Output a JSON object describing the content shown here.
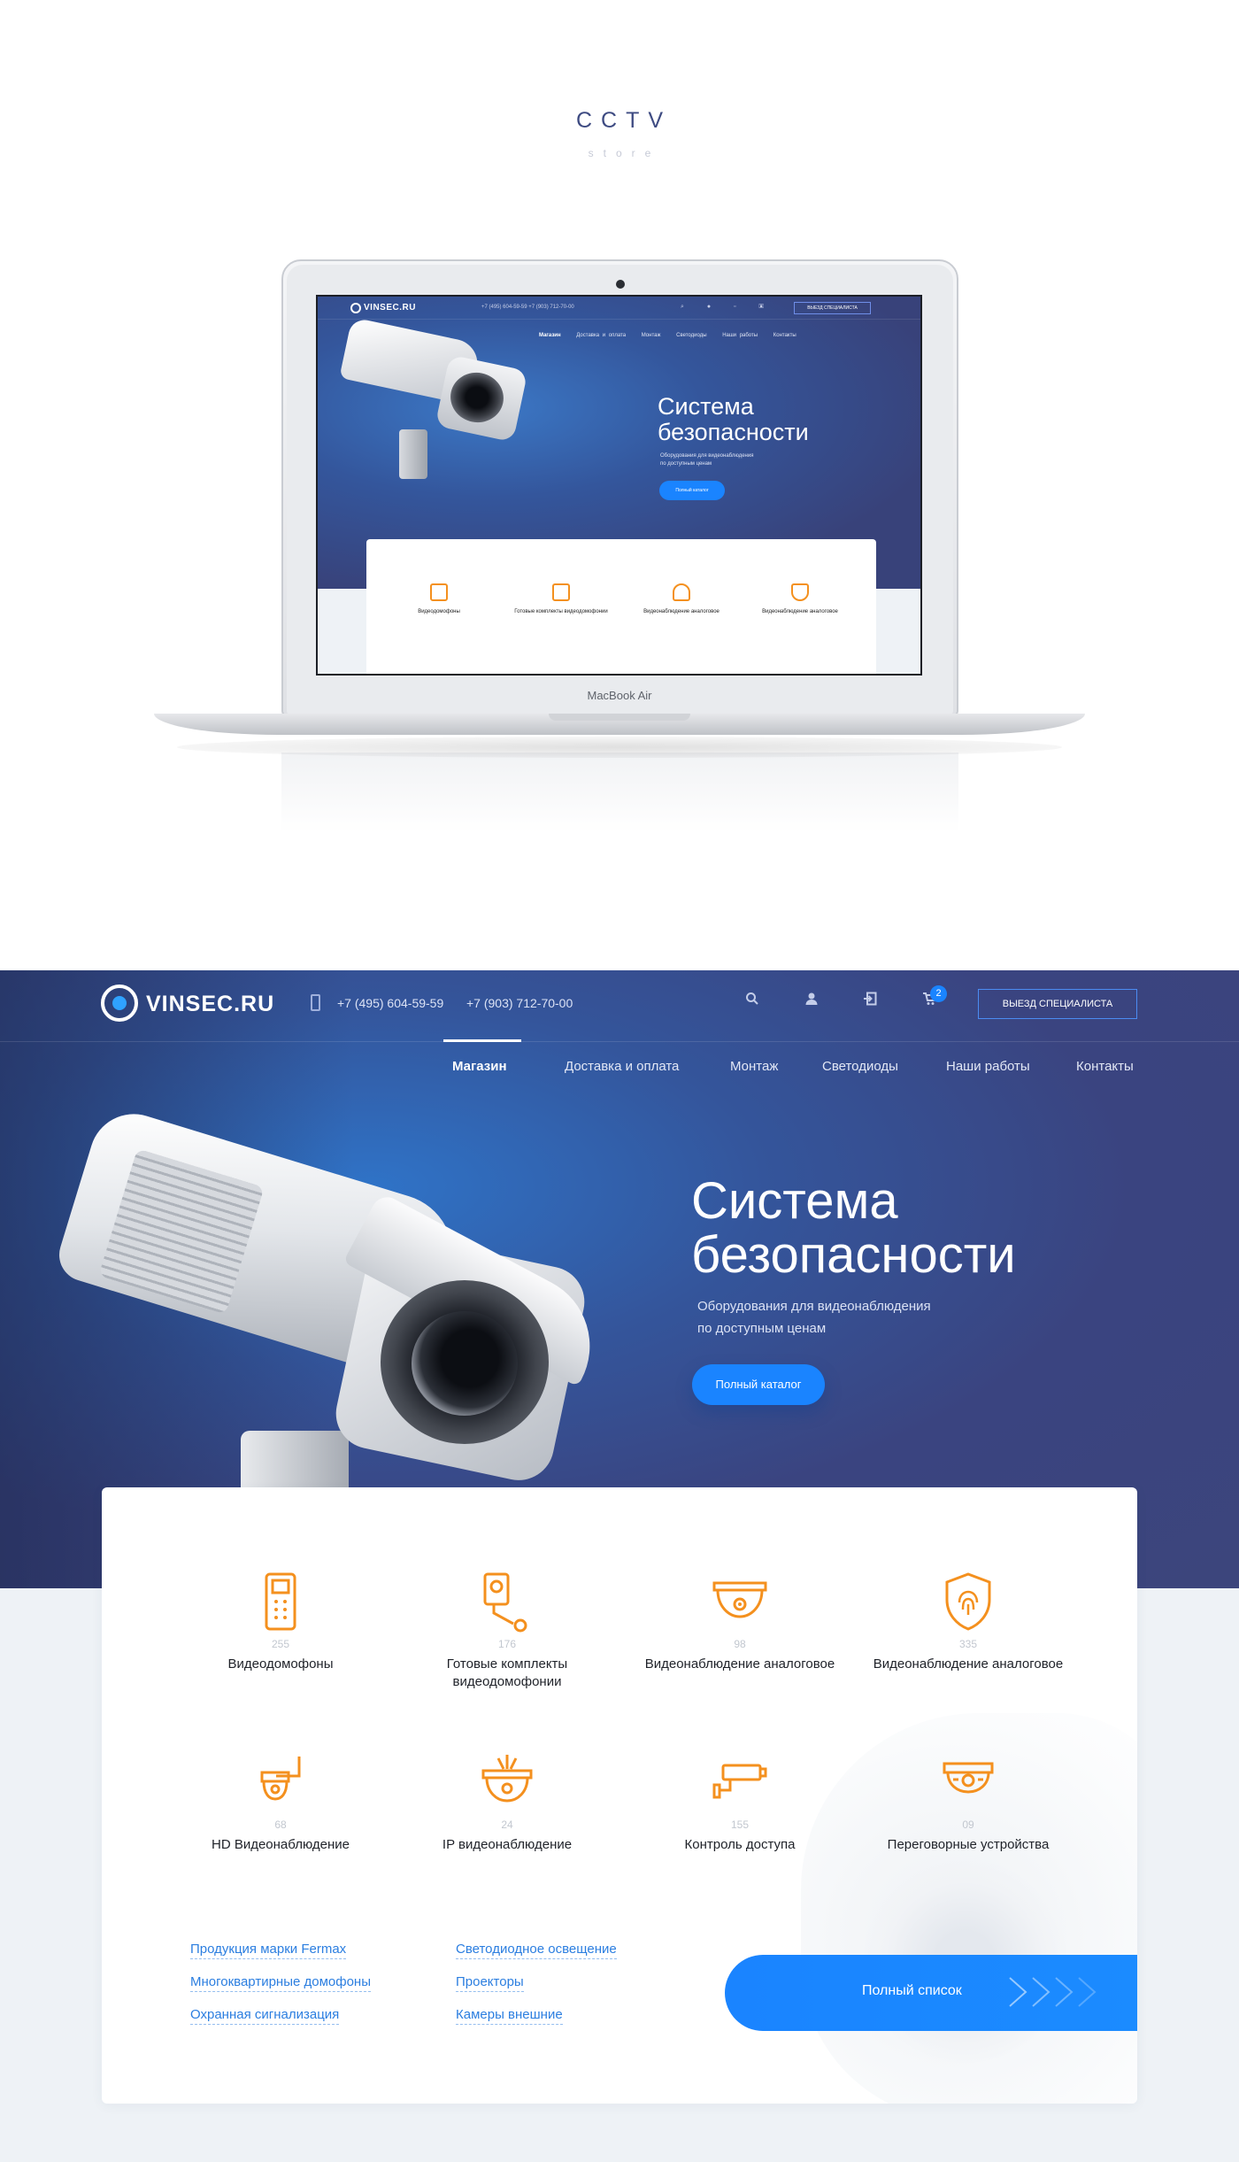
{
  "presentation": {
    "title": "CCTV",
    "subtitle": "store",
    "laptop_label": "MacBook Air"
  },
  "header": {
    "logo": "VINSEC.RU",
    "phone1": "+7 (495) 604-59-59",
    "phone2": "+7 (903) 712-70-00",
    "cart_count": "2",
    "specialist_button": "ВЫЕЗД СПЕЦИАЛИСТА",
    "icons": [
      "search-icon",
      "user-icon",
      "login-icon",
      "cart-icon"
    ]
  },
  "mini_header": {
    "phones": "+7 (495) 604-59-59   +7 (903) 712-70-00",
    "specialist_button": "ВЫЕЗД СПЕЦИАЛИСТА"
  },
  "nav": {
    "items": [
      "Магазин",
      "Доставка и оплата",
      "Монтаж",
      "Светодиоды",
      "Наши работы",
      "Контакты"
    ],
    "active": "Магазин"
  },
  "hero": {
    "title_line1": "Система",
    "title_line2": "безопасности",
    "sub_line1": "Оборудования для видеонаблюдения",
    "sub_line2": "по доступным ценам",
    "button": "Полный каталог"
  },
  "categories": [
    {
      "count": "255",
      "label": "Видеодомофоны",
      "icon": "intercom-icon"
    },
    {
      "count": "176",
      "label": "Готовые комплекты видеодомофонии",
      "icon": "intercom-kit-icon"
    },
    {
      "count": "98",
      "label": "Видеонаблюдение аналоговое",
      "icon": "dome-camera-icon"
    },
    {
      "count": "335",
      "label": "Видеонаблюдение аналоговое",
      "icon": "fingerprint-shield-icon"
    },
    {
      "count": "68",
      "label": "HD Видеонаблюдение",
      "icon": "hd-camera-icon"
    },
    {
      "count": "24",
      "label": "IP видеонаблюдение",
      "icon": "ip-camera-icon"
    },
    {
      "count": "155",
      "label": "Контроль доступа",
      "icon": "access-control-icon"
    },
    {
      "count": "09",
      "label": "Переговорные устройства",
      "icon": "intercom-device-icon"
    }
  ],
  "mini_categories": [
    "Видеодомофоны",
    "Готовые комплекты видеодомофонии",
    "Видеонаблюдение аналоговое",
    "Видеонаблюдение аналоговое"
  ],
  "links_col1": [
    "Продукция марки Fermax",
    "Многоквартирные домофоны",
    "Охранная сигнализация"
  ],
  "links_col2": [
    "Светодиодное освещение",
    "Проекторы",
    "Камеры внешние"
  ],
  "full_list_button": "Полный список",
  "colors": {
    "accent": "#1a84ff",
    "hero": "#3a4480",
    "icon": "#f4901e"
  }
}
